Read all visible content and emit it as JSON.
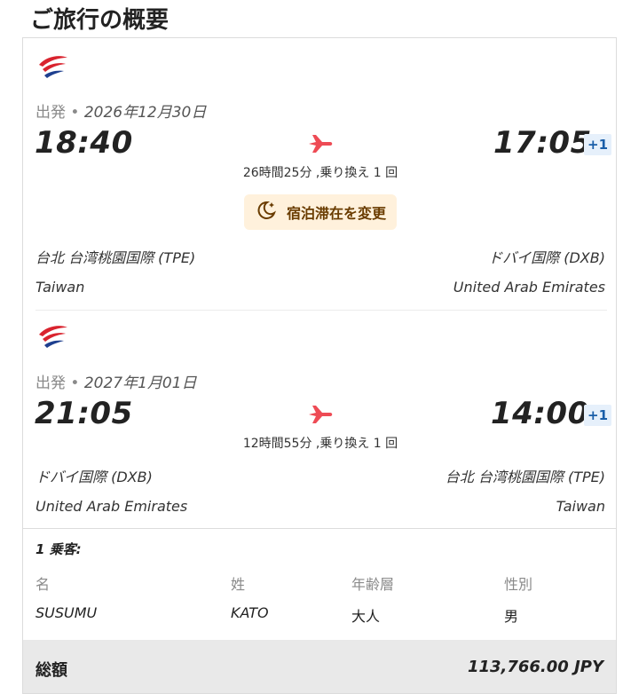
{
  "page_title": "ご旅行の概要",
  "segments": [
    {
      "depart_label": "出発",
      "depart_date": "2026年12月30日",
      "depart_time": "18:40",
      "arrive_time": "17:05",
      "day_offset": "+1",
      "duration": "26時間25分 ,乗り換え 1 回",
      "origin_airport": "台北 台湾桃園国際 (TPE)",
      "origin_country": "Taiwan",
      "dest_airport": "ドバイ国際 (DXB)",
      "dest_country": "United Arab Emirates"
    },
    {
      "depart_label": "出発",
      "depart_date": "2027年1月01日",
      "depart_time": "21:05",
      "arrive_time": "14:00",
      "day_offset": "+1",
      "duration": "12時間55分 ,乗り換え 1 回",
      "origin_airport": "ドバイ国際 (DXB)",
      "origin_country": "United Arab Emirates",
      "dest_airport": "台北 台湾桃園国際 (TPE)",
      "dest_country": "Taiwan"
    }
  ],
  "stay_button_label": "宿泊滞在を変更",
  "passengers": {
    "title": "1 乗客:",
    "headers": [
      "名",
      "姓",
      "年齢層",
      "性別"
    ],
    "rows": [
      [
        "SUSUMU",
        "KATO",
        "大人",
        "男"
      ]
    ]
  },
  "total": {
    "label": "総額",
    "value": "113,766.00 JPY"
  },
  "colors": {
    "plane_icon": "#ee4b55",
    "airline_red": "#d9232e",
    "airline_blue": "#1e3f8f",
    "plus_badge_bg": "#e6f0fb",
    "plus_badge_text": "#1a5ea8",
    "stay_button_bg": "#fff1dc",
    "total_bar_bg": "#e9e9e9"
  },
  "icons": {
    "airline_logo": "airline-logo-icon",
    "plane": "plane-icon",
    "moon": "moon-stars-icon"
  }
}
